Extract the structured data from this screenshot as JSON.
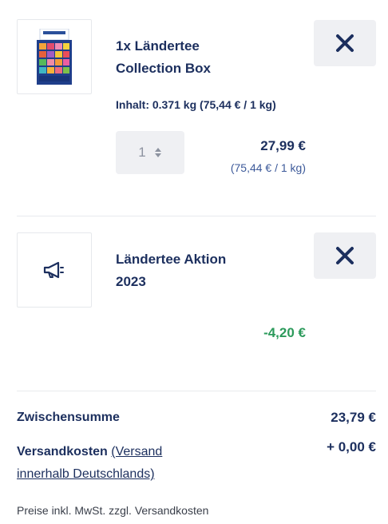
{
  "items": [
    {
      "title_line1": "1x Ländertee",
      "title_line2": "Collection Box",
      "content": "Inhalt: 0.371 kg (75,44 € / 1 kg)",
      "quantity": "1",
      "price": "27,99 €",
      "unit_price": "(75,44 € / 1 kg)",
      "image_icon": "tea-box-product-image",
      "remove_icon": "close-icon"
    },
    {
      "title_line1": "Ländertee Aktion",
      "title_line2": "2023",
      "discount": "-4,20 €",
      "image_icon": "megaphone-icon",
      "remove_icon": "close-icon"
    }
  ],
  "summary": {
    "subtotal_label": "Zwischensumme",
    "subtotal_value": "23,79 €",
    "shipping_label": "Versandkosten",
    "shipping_link_line1": "(Versand",
    "shipping_link_line2": "innerhalb Deutschlands)",
    "shipping_value": "+ 0,00 €",
    "note": "Preise inkl. MwSt. zzgl. Versandkosten"
  },
  "colors": {
    "text": "#1c2f5e",
    "unit_price": "#3d5a9a",
    "discount": "#2c9a5b",
    "button_bg": "#eff0f3"
  }
}
